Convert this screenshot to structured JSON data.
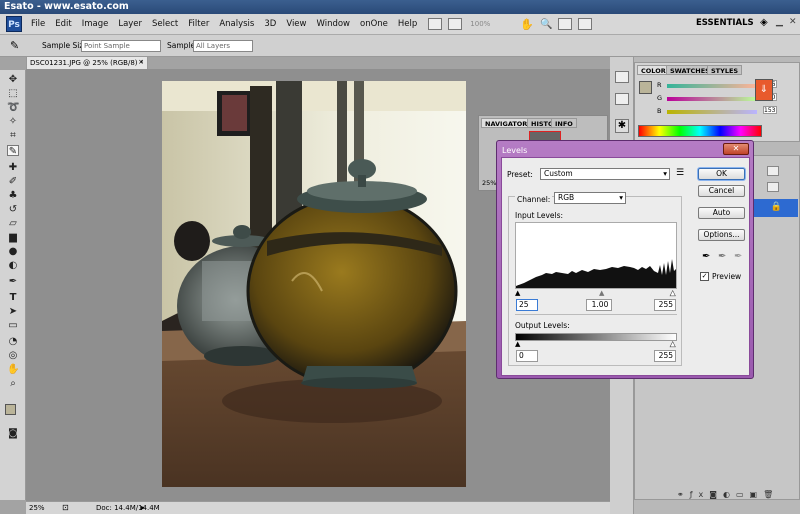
{
  "window_title": "Esato - www.esato.com",
  "app": {
    "logo": "Ps",
    "workspace": "ESSENTIALS",
    "zoom_menu": "100%"
  },
  "menu": [
    "File",
    "Edit",
    "Image",
    "Layer",
    "Select",
    "Filter",
    "Analysis",
    "3D",
    "View",
    "Window",
    "onOne",
    "Help"
  ],
  "options_bar": {
    "sample_size_label": "Sample Size:",
    "sample_size_value": "Point Sample",
    "sample_label": "Sample:",
    "sample_value": "All Layers"
  },
  "document": {
    "tab": "DSC01231.JPG @ 25% (RGB/8) *"
  },
  "status": {
    "zoom": "25%",
    "doc": "Doc: 14.4M/14.4M"
  },
  "navigator": {
    "tabs": [
      "NAVIGATOR",
      "HISTO",
      "INFO"
    ],
    "zoom": "25%"
  },
  "color_panel": {
    "tabs": [
      "COLOR",
      "SWATCHES",
      "STYLES"
    ],
    "channels": [
      {
        "label": "R",
        "value": "186"
      },
      {
        "label": "G",
        "value": "180"
      },
      {
        "label": "B",
        "value": "153"
      }
    ],
    "foreground_color": "#bab499"
  },
  "levels_dialog": {
    "title": "Levels",
    "preset_label": "Preset:",
    "preset_value": "Custom",
    "channel_label": "Channel:",
    "channel_value": "RGB",
    "input_levels_label": "Input Levels:",
    "input_black": "25",
    "input_gamma": "1.00",
    "input_white": "255",
    "output_levels_label": "Output Levels:",
    "output_black": "0",
    "output_white": "255",
    "buttons": {
      "ok": "OK",
      "cancel": "Cancel",
      "auto": "Auto",
      "options": "Options..."
    },
    "preview_label": "Preview",
    "preview_checked": true
  }
}
